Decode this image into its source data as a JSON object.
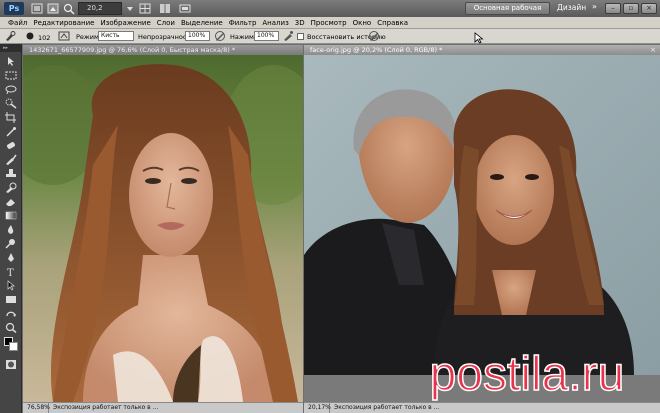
{
  "app": {
    "logo": "Ps",
    "zoom_value": "20,2",
    "workspace_button": "Основная рабочая среда",
    "workspace_design": "Дизайн",
    "more_arrows": "»"
  },
  "menu": [
    "Файл",
    "Редактирование",
    "Изображение",
    "Слои",
    "Выделение",
    "Фильтр",
    "Анализ",
    "3D",
    "Просмотр",
    "Окно",
    "Справка"
  ],
  "options": {
    "brush_size": "102",
    "mode_label": "Режим:",
    "mode_value": "Кисть",
    "opacity_label": "Непрозрачность:",
    "opacity_value": "100%",
    "pressure_label": "Нажим:",
    "pressure_value": "100%",
    "history_label": "Восстановить историю"
  },
  "documents": {
    "left": {
      "title": "1432671_66577909.jpg @ 76,6% (Слой 0, Быстрая маска/8) *",
      "zoom": "76,58%",
      "status": "Экспозиция работает только в ..."
    },
    "right": {
      "title": "face-orig.jpg @ 20,2% (Слой 0, RGB/8) *",
      "zoom": "20,17%",
      "status": "Экспозиция работает только в ..."
    }
  },
  "watermark": {
    "text": "postila.ru",
    "color": "#e8334a"
  },
  "colors": {
    "foreground": "#000000",
    "background": "#ffffff",
    "canvas_right_bg": "#9fb0b5"
  }
}
